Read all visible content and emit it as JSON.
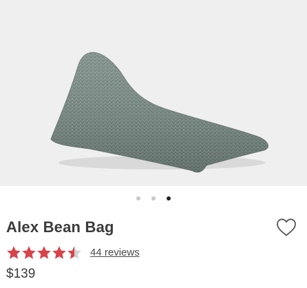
{
  "product": {
    "name": "Alex Bean Bag",
    "price": "$139",
    "reviews_label": "44 reviews",
    "rating": 4.5,
    "rating_max": 5
  },
  "carousel": {
    "slide_count": 3,
    "active_index": 2
  },
  "icons": {
    "favorite": "heart-outline-icon",
    "star": "star-icon"
  },
  "colors": {
    "star_filled": "#d8434a",
    "star_empty": "#d2d2d2",
    "product_fabric": "#7f908a"
  }
}
